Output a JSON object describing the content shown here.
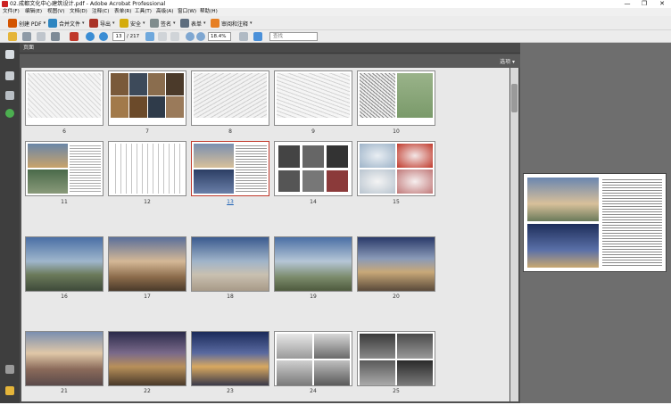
{
  "window": {
    "title": "02.成都文化中心建筑设计.pdf - Adobe Acrobat Professional",
    "minimize": "—",
    "restore": "❐",
    "close": "✕"
  },
  "menu": [
    "文件(F)",
    "编辑(E)",
    "视图(V)",
    "文档(D)",
    "注释(C)",
    "表单(R)",
    "工具(T)",
    "高级(A)",
    "窗口(W)",
    "帮助(H)"
  ],
  "toolbar": {
    "create_pdf": "创建 PDF",
    "combine": "合并文件",
    "export": "导出",
    "secure": "安全",
    "sign": "签名",
    "forms": "表单",
    "review": "审阅和注释"
  },
  "nav": {
    "current_page": "13",
    "page_count": "/ 217",
    "zoom": "18.4%",
    "search_placeholder": "查找"
  },
  "panel": {
    "title": "页面",
    "options": "选项 ▾"
  },
  "thumbnails": {
    "row1": [
      "6",
      "7",
      "8",
      "9",
      "10"
    ],
    "row2": [
      "11",
      "12",
      "13",
      "14",
      "15"
    ],
    "row3": [
      "16",
      "17",
      "18",
      "19",
      "20"
    ],
    "row4": [
      "21",
      "22",
      "23",
      "24",
      "25"
    ],
    "selected": "13"
  },
  "colors": {
    "selection": "#c0392b",
    "panel_bg": "#505050",
    "nav_bg": "#3e3e3e"
  }
}
